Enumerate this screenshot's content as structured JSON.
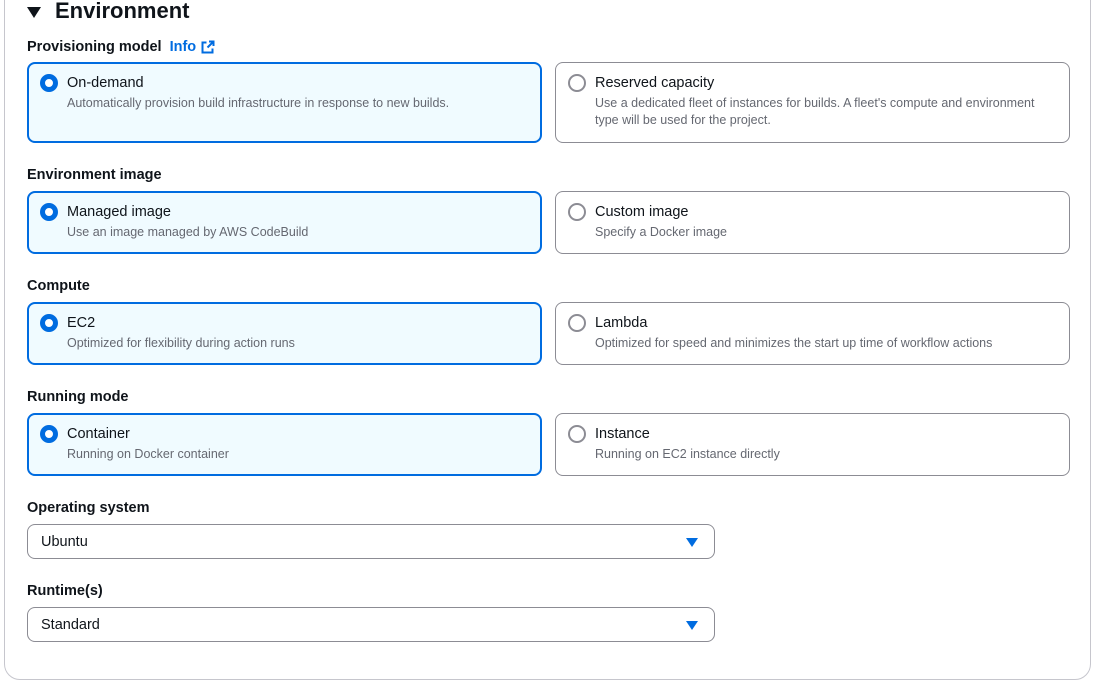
{
  "section": {
    "title": "Environment"
  },
  "provisioning": {
    "label": "Provisioning model",
    "info": "Info",
    "options": [
      {
        "title": "On-demand",
        "desc": "Automatically provision build infrastructure in response to new builds.",
        "selected": true
      },
      {
        "title": "Reserved capacity",
        "desc": "Use a dedicated fleet of instances for builds. A fleet's compute and environment type will be used for the project.",
        "selected": false
      }
    ]
  },
  "env_image": {
    "label": "Environment image",
    "options": [
      {
        "title": "Managed image",
        "desc": "Use an image managed by AWS CodeBuild",
        "selected": true
      },
      {
        "title": "Custom image",
        "desc": "Specify a Docker image",
        "selected": false
      }
    ]
  },
  "compute": {
    "label": "Compute",
    "options": [
      {
        "title": "EC2",
        "desc": "Optimized for flexibility during action runs",
        "selected": true
      },
      {
        "title": "Lambda",
        "desc": "Optimized for speed and minimizes the start up time of workflow actions",
        "selected": false
      }
    ]
  },
  "running_mode": {
    "label": "Running mode",
    "options": [
      {
        "title": "Container",
        "desc": "Running on Docker container",
        "selected": true
      },
      {
        "title": "Instance",
        "desc": "Running on EC2 instance directly",
        "selected": false
      }
    ]
  },
  "os": {
    "label": "Operating system",
    "value": "Ubuntu"
  },
  "runtime": {
    "label": "Runtime(s)",
    "value": "Standard"
  },
  "colors": {
    "accent": "#006ce0",
    "selected_bg": "#f0fbff",
    "border": "#8c8c94",
    "muted_text": "#656871"
  }
}
